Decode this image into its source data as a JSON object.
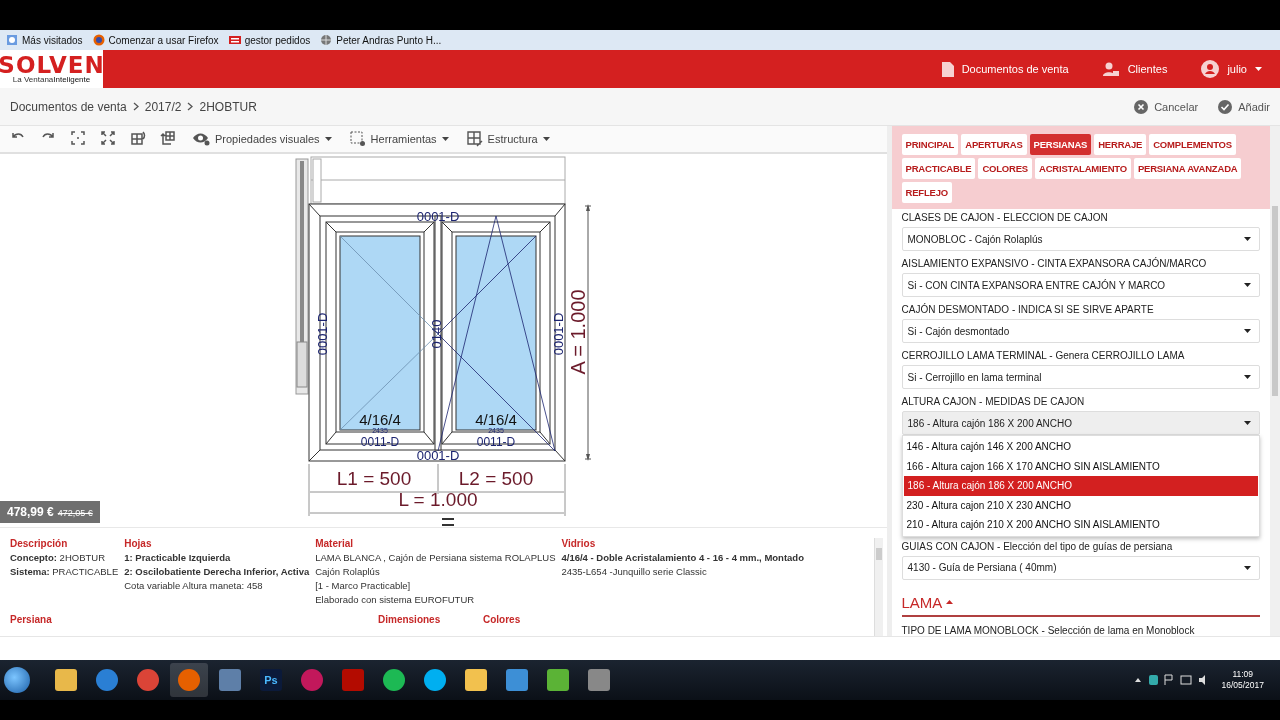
{
  "bookmarks": [
    {
      "label": "Más visitados",
      "kind": "page"
    },
    {
      "label": "Comenzar a usar Firefox",
      "kind": "firefox"
    },
    {
      "label": "gestor pedidos",
      "kind": "app"
    },
    {
      "label": "Peter Andras Punto H...",
      "kind": "globe"
    }
  ],
  "header": {
    "logo": "SOLVEN",
    "tagline_a": "La Ventana",
    "tagline_b": "Inteligente",
    "nav": [
      {
        "label": "Documentos de venta",
        "kind": "document"
      },
      {
        "label": "Clientes",
        "kind": "people"
      }
    ],
    "user": "julio"
  },
  "breadcrumb": [
    "Documentos de venta",
    "2017/2",
    "2HOBTUR"
  ],
  "actions": [
    {
      "label": "Cancelar",
      "kind": "cancel"
    },
    {
      "label": "Añadir",
      "kind": "add"
    }
  ],
  "toolbar": {
    "tools": [
      {
        "kind": "undo"
      },
      {
        "kind": "redo"
      },
      {
        "kind": "focus"
      },
      {
        "kind": "fullscreen"
      },
      {
        "kind": "grid"
      },
      {
        "kind": "insert"
      }
    ],
    "menus": [
      {
        "label": "Propiedades visuales",
        "kind": "eye"
      },
      {
        "label": "Herramientas",
        "kind": "select"
      },
      {
        "label": "Estructura",
        "kind": "grid"
      }
    ]
  },
  "drawing": {
    "profile_labels": [
      "0001-D",
      "0001-D",
      "0140",
      "0001-D",
      "0001-D"
    ],
    "sashes": [
      {
        "kind": "turn",
        "glass": "4/16/4",
        "bead": "2435",
        "profile": "0011-D"
      },
      {
        "kind": "tilt_turn",
        "glass": "4/16/4",
        "bead": "2435",
        "profile": "0011-D"
      }
    ],
    "height_label": "A = 1.000",
    "width_labels": [
      "L1 = 500",
      "L2 = 500"
    ],
    "total_width_label": "L = 1.000"
  },
  "price": {
    "value": "478,99 €",
    "previous": "472,05 €"
  },
  "details": {
    "columns": [
      {
        "heading": "Descripción",
        "lines": [
          {
            "text": "**Concepto:** 2HOBTUR",
            "bold": false
          },
          {
            "text": "**Sistema:** PRACTICABLE",
            "bold": false
          }
        ]
      },
      {
        "heading": "Hojas",
        "lines": [
          {
            "text": "1: Practicable Izquierda",
            "bold": true
          },
          {
            "text": "2: Oscilobatiente Derecha Inferior, Activa",
            "bold": true
          },
          {
            "text": "Cota variable Altura maneta: 458",
            "bold": false
          }
        ]
      },
      {
        "heading": "Material",
        "lines": [
          {
            "text": "LAMA BLANCA , Cajón de Persiana sistema ROLAPLUS",
            "bold": false
          },
          {
            "text": "Cajón Rolaplús",
            "bold": false
          },
          {
            "text": "[1 - Marco Practicable]",
            "bold": false
          },
          {
            "text": "Elaborado con sistema EUROFUTUR",
            "bold": false
          }
        ]
      },
      {
        "heading": "Vidrios",
        "lines": [
          {
            "text": "4/16/4 - Doble Acristalamiento 4 - 16 - 4 mm., Montado",
            "bold": true
          },
          {
            "text": "2435-L654 -Junquillo serie Classic",
            "bold": false
          }
        ]
      }
    ],
    "more_headings": [
      "Persiana",
      "Dimensiones",
      "Colores"
    ]
  },
  "tabs": [
    {
      "label": "PRINCIPAL",
      "selected": false
    },
    {
      "label": "APERTURAS",
      "selected": false
    },
    {
      "label": "PERSIANAS",
      "selected": true
    },
    {
      "label": "HERRAJE",
      "selected": false
    },
    {
      "label": "COMPLEMENTOS",
      "selected": false
    },
    {
      "label": "PRACTICABLE",
      "selected": false
    },
    {
      "label": "COLORES",
      "selected": false
    },
    {
      "label": "ACRISTALAMIENTO",
      "selected": false
    },
    {
      "label": "PERSIANA AVANZADA",
      "selected": false
    },
    {
      "label": "REFLEJO",
      "selected": false
    }
  ],
  "fields": [
    {
      "label": "CLASES DE CAJON - ELECCION DE CAJON",
      "value": "MONOBLOC - Cajón Rolaplús",
      "expanded": false
    },
    {
      "label": "AISLAMIENTO EXPANSIVO - CINTA EXPANSORA CAJÓN/MARCO",
      "value": "Si - CON CINTA EXPANSORA ENTRE CAJÓN Y MARCO",
      "expanded": false
    },
    {
      "label": "CAJÓN DESMONTADO - INDICA SI SE SIRVE APARTE",
      "value": "Si - Cajón desmontado",
      "expanded": false
    },
    {
      "label": "CERROJILLO LAMA TERMINAL - Genera CERROJILLO LAMA",
      "value": "Si - Cerrojillo en lama terminal",
      "expanded": false
    },
    {
      "label": "ALTURA CAJON - MEDIDAS DE CAJON",
      "value": "186 - Altura cajón 186 X 200 ANCHO",
      "expanded": true,
      "options": [
        {
          "label": "146 - Altura cajón 146 X 200 ANCHO",
          "selected": false
        },
        {
          "label": "166 - Altura cajon 166 X 170 ANCHO SIN AISLAMIENTO",
          "selected": false
        },
        {
          "label": "186 - Altura cajón 186 X 200 ANCHO",
          "selected": true
        },
        {
          "label": "230 - Altura cajon 210 X 230 ANCHO",
          "selected": false
        },
        {
          "label": "210 - Altura cajón 210 X 200 ANCHO SIN AISLAMIENTO",
          "selected": false
        }
      ]
    },
    {
      "label": "GUIAS CON CAJON - Elección del tipo de guías de persiana",
      "value": "4130 - Guía de Persiana ( 40mm)",
      "expanded": false
    }
  ],
  "section": {
    "title": "LAMA",
    "expanded": true,
    "next_label": "TIPO DE LAMA MONOBLOCK - Selección de lama en Monoblock"
  },
  "taskbar": {
    "apps": [
      {
        "kind": "folder"
      },
      {
        "kind": "ie"
      },
      {
        "kind": "chrome"
      },
      {
        "kind": "firefox",
        "selected": true
      },
      {
        "kind": "computer",
        "selected": false
      },
      {
        "kind": "ps",
        "label": "Ps"
      },
      {
        "kind": "pink"
      },
      {
        "kind": "pdf"
      },
      {
        "kind": "spotify"
      },
      {
        "kind": "skype"
      },
      {
        "kind": "mail"
      },
      {
        "kind": "tool"
      },
      {
        "kind": "green"
      },
      {
        "kind": "remote"
      }
    ],
    "time": "11:09",
    "date": "16/05/2017"
  }
}
